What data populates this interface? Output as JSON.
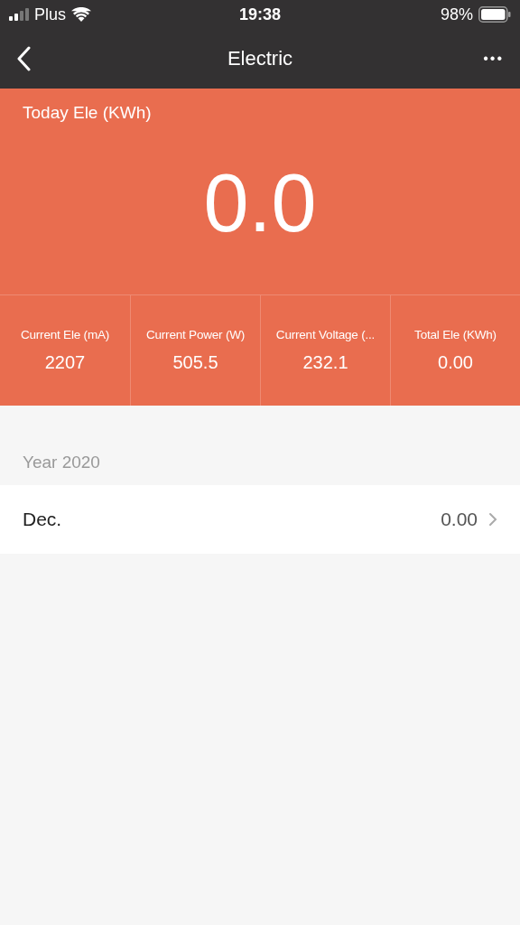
{
  "status_bar": {
    "carrier": "Plus",
    "time": "19:38",
    "battery": "98%"
  },
  "nav": {
    "title": "Electric",
    "more": "•••"
  },
  "today": {
    "label": "Today Ele (KWh)",
    "value": "0.0"
  },
  "stats": [
    {
      "label": "Current Ele (mA)",
      "value": "2207"
    },
    {
      "label": "Current Power (W)",
      "value": "505.5"
    },
    {
      "label": "Current Voltage (...",
      "value": "232.1"
    },
    {
      "label": "Total Ele (KWh)",
      "value": "0.00"
    }
  ],
  "section": {
    "title": "Year 2020",
    "rows": [
      {
        "label": "Dec.",
        "value": "0.00"
      }
    ]
  }
}
